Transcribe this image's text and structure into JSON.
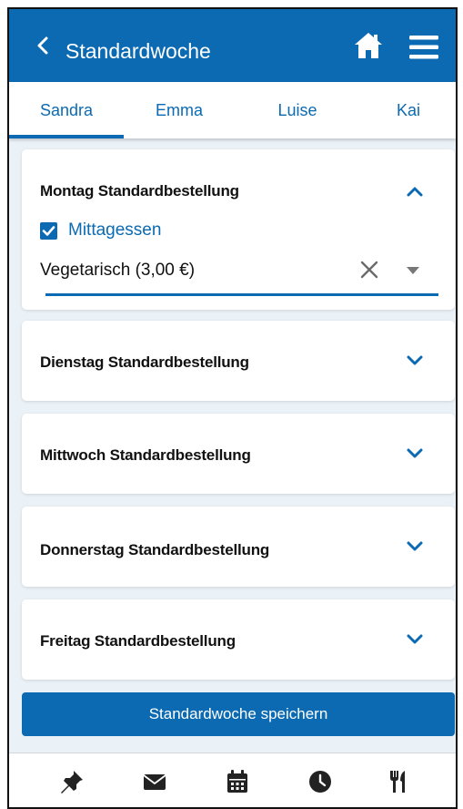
{
  "header": {
    "title": "Standardwoche",
    "back_icon": "chevron-left-icon",
    "home_icon": "home-icon",
    "menu_icon": "hamburger-menu-icon"
  },
  "tabs": [
    {
      "label": "Sandra",
      "active": true
    },
    {
      "label": "Emma",
      "active": false
    },
    {
      "label": "Luise",
      "active": false
    },
    {
      "label": "Kai",
      "active": false
    }
  ],
  "days": [
    {
      "title": "Montag Standardbestellung",
      "expanded": true,
      "meal_checkbox": {
        "label": "Mittagessen",
        "checked": true
      },
      "selection": {
        "value": "Vegetarisch (3,00 €)"
      }
    },
    {
      "title": "Dienstag Standardbestellung",
      "expanded": false
    },
    {
      "title": "Mittwoch Standardbestellung",
      "expanded": false
    },
    {
      "title": "Donnerstag Standardbestellung",
      "expanded": false
    },
    {
      "title": "Freitag Standardbestellung",
      "expanded": false
    }
  ],
  "save_button": {
    "label": "Standardwoche speichern"
  },
  "bottom_nav": [
    {
      "icon": "pin-icon"
    },
    {
      "icon": "envelope-icon"
    },
    {
      "icon": "calendar-icon"
    },
    {
      "icon": "clock-icon"
    },
    {
      "icon": "cutlery-icon"
    }
  ],
  "colors": {
    "primary": "#0b6ab2",
    "background": "#eaf1f7",
    "card": "#ffffff",
    "text": "#111111"
  }
}
